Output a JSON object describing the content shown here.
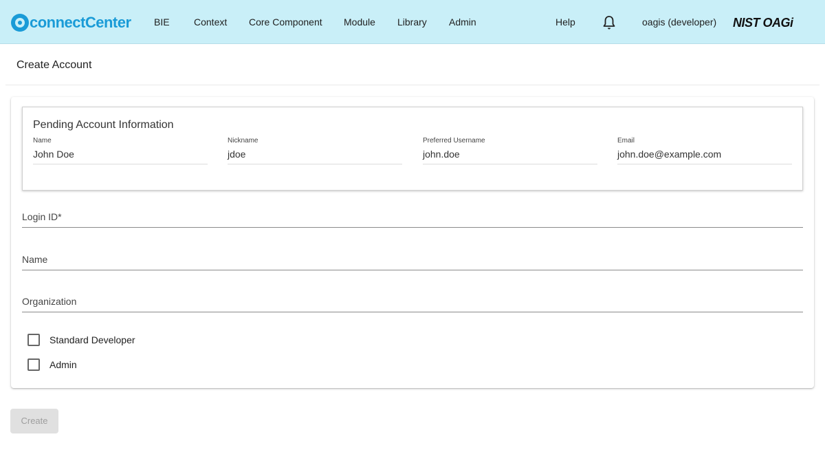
{
  "header": {
    "logo_text": "connectCenter",
    "nav": [
      "BIE",
      "Context",
      "Core Component",
      "Module",
      "Library",
      "Admin"
    ],
    "help_label": "Help",
    "user_label": "oagis (developer)",
    "brand_label": "NIST OAGi",
    "bell_icon": "notifications-bell-icon"
  },
  "page": {
    "title": "Create Account"
  },
  "pending": {
    "title": "Pending Account Information",
    "fields": [
      {
        "label": "Name",
        "value": "John Doe"
      },
      {
        "label": "Nickname",
        "value": "jdoe"
      },
      {
        "label": "Preferred Username",
        "value": "john.doe"
      },
      {
        "label": "Email",
        "value": "john.doe@example.com"
      }
    ]
  },
  "form": {
    "login_id_label": "Login ID*",
    "name_label": "Name",
    "organization_label": "Organization",
    "standard_developer_label": "Standard Developer",
    "standard_developer_checked": false,
    "admin_label": "Admin",
    "admin_checked": false
  },
  "actions": {
    "create_label": "Create",
    "create_disabled": true
  },
  "colors": {
    "topbar_bg": "#c9eff8",
    "logo_blue": "#1a9bd7",
    "disabled_button_bg": "#e0e0e0"
  }
}
